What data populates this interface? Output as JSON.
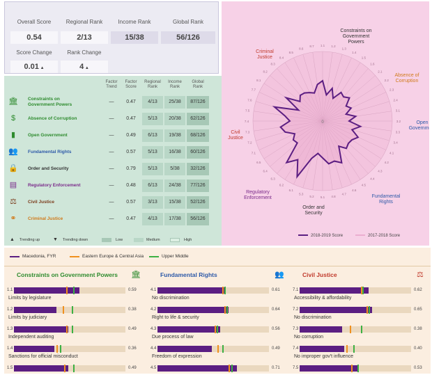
{
  "score": {
    "labels": {
      "overall": "Overall Score",
      "regional": "Regional Rank",
      "income": "Income Rank",
      "global": "Global Rank",
      "change": "Score Change",
      "rank_change": "Rank Change"
    },
    "values": {
      "overall": "0.54",
      "regional": "2/13",
      "income": "15/38",
      "global": "56/126",
      "change": "0.01",
      "rank_change": "4"
    }
  },
  "table": {
    "headers": {
      "trend": "Factor\nTrend",
      "score": "Factor\nScore",
      "regional": "Regional\nRank",
      "income": "Income\nRank",
      "global": "Global\nRank"
    },
    "rows": [
      {
        "name": "Constraints on\nGovernment Powers",
        "color": "#2e8b2e",
        "icon": "building-icon",
        "glyph": "🏛",
        "trend": "—",
        "score": "0.47",
        "regional": "4/13",
        "income": "25/38",
        "global": "87/126"
      },
      {
        "name": "Absence of Corruption",
        "color": "#2e8b2e",
        "icon": "money-bag-icon",
        "glyph": "$",
        "trend": "—",
        "score": "0.47",
        "regional": "5/13",
        "income": "20/38",
        "global": "62/126"
      },
      {
        "name": "Open Government",
        "color": "#2e8b2e",
        "icon": "door-icon",
        "glyph": "▮",
        "trend": "—",
        "score": "0.49",
        "regional": "6/13",
        "income": "19/38",
        "global": "68/126"
      },
      {
        "name": "Fundamental Rights",
        "color": "#2e5aa8",
        "icon": "people-icon",
        "glyph": "👥",
        "trend": "—",
        "score": "0.57",
        "regional": "5/13",
        "income": "16/38",
        "global": "60/126"
      },
      {
        "name": "Order and Security",
        "color": "#333333",
        "icon": "lock-icon",
        "glyph": "🔒",
        "trend": "—",
        "score": "0.79",
        "regional": "5/13",
        "income": "5/38",
        "global": "32/126"
      },
      {
        "name": "Regulatory Enforcement",
        "color": "#7a2a8a",
        "icon": "document-icon",
        "glyph": "▤",
        "trend": "—",
        "score": "0.48",
        "regional": "6/13",
        "income": "24/38",
        "global": "77/126"
      },
      {
        "name": "Civil Justice",
        "color": "#7a3a1a",
        "icon": "scales-icon",
        "glyph": "⚖",
        "trend": "—",
        "score": "0.57",
        "regional": "3/13",
        "income": "15/38",
        "global": "52/126"
      },
      {
        "name": "Criminal Justice",
        "color": "#d07a1a",
        "icon": "handcuffs-icon",
        "glyph": "⚭",
        "trend": "—",
        "score": "0.47",
        "regional": "4/13",
        "income": "17/38",
        "global": "56/126"
      }
    ],
    "legend": {
      "up": "Trending up",
      "down": "Trending down",
      "low": "Low",
      "medium": "Medium",
      "high": "High"
    }
  },
  "radar": {
    "labels": {
      "constraints": "Constraints on\nGovernment\nPowers",
      "corruption": "Absence of\nCorruption",
      "open": "Open\nGovernment",
      "rights": "Fundamental\nRights",
      "order": "Order and\nSecurity",
      "regulatory": "Regulatory\nEnforcement",
      "civil": "Civil\nJustice",
      "criminal": "Criminal\nJustice"
    },
    "center": "0",
    "legend": {
      "current": "2018-2019 Score",
      "previous": "2017-2018 Score"
    },
    "colors": {
      "current": "#5b1e82",
      "previous": "#e7a3c8"
    },
    "current": [
      0.58,
      0.38,
      0.49,
      0.36,
      0.49,
      0.46,
      0.51,
      0.4,
      0.45,
      0.35,
      0.48,
      0.38,
      0.55,
      0.44,
      0.56,
      0.5,
      0.49,
      0.52,
      0.43,
      0.66,
      0.6,
      0.62,
      0.53,
      0.47,
      0.56,
      0.88,
      0.66,
      0.79,
      0.48,
      0.5,
      0.44,
      0.56,
      0.61,
      0.47,
      0.55,
      0.72,
      0.38,
      0.62,
      0.43,
      0.49,
      0.48,
      0.45,
      0.42,
      0.53
    ],
    "previous": [
      0.56,
      0.4,
      0.48,
      0.37,
      0.48,
      0.45,
      0.5,
      0.41,
      0.44,
      0.36,
      0.47,
      0.39,
      0.54,
      0.45,
      0.55,
      0.49,
      0.48,
      0.51,
      0.44,
      0.65,
      0.59,
      0.61,
      0.52,
      0.48,
      0.55,
      0.86,
      0.65,
      0.78,
      0.49,
      0.49,
      0.45,
      0.55,
      0.6,
      0.48,
      0.54,
      0.71,
      0.39,
      0.61,
      0.44,
      0.48,
      0.49,
      0.46,
      0.43,
      0.52
    ],
    "tick_labels": [
      "1.1",
      "1.2",
      "1.3",
      "1.4",
      "1.5",
      "1.6",
      "2.1",
      "2.2",
      "2.3",
      "2.4",
      "3.1",
      "3.2",
      "3.3",
      "3.4",
      "4.1",
      "4.2",
      "4.3",
      "4.4",
      "4.5",
      "4.6",
      "4.7",
      "4.8",
      "5.1",
      "5.2",
      "5.3",
      "6.1",
      "6.2",
      "6.3",
      "6.4",
      "6.5",
      "7.1",
      "7.2",
      "7.3",
      "7.4",
      "7.5",
      "7.6",
      "7.7",
      "8.1",
      "8.2",
      "8.3",
      "8.4",
      "8.5",
      "8.6",
      "8.7"
    ]
  },
  "bars": {
    "legend": {
      "country": "Macedonia, FYR",
      "region": "Eastern Europe & Central Asia",
      "income": "Upper Middle"
    },
    "colors": {
      "country": "#5b1e82",
      "region": "#f0901e",
      "income": "#3cb043"
    },
    "groups": [
      {
        "title": "Constraints on Government Powers",
        "title_color": "#2e8b2e",
        "icon": "building-icon",
        "glyph": "🏛",
        "items": [
          {
            "num": "1.1",
            "label": "Limits by legislature",
            "value": 0.59,
            "region": 0.47,
            "income": 0.53
          },
          {
            "num": "1.2",
            "label": "Limits by judiciary",
            "value": 0.38,
            "region": 0.44,
            "income": 0.52
          },
          {
            "num": "1.3",
            "label": "Independent auditing",
            "value": 0.49,
            "region": 0.47,
            "income": 0.52
          },
          {
            "num": "1.4",
            "label": "Sanctions for official misconduct",
            "value": 0.36,
            "region": 0.38,
            "income": 0.41
          },
          {
            "num": "1.5",
            "label": "",
            "value": 0.49,
            "region": 0.45,
            "income": 0.53
          }
        ]
      },
      {
        "title": "Fundamental Rights",
        "title_color": "#2e5aa8",
        "icon": "people-icon",
        "glyph": "👥",
        "items": [
          {
            "num": "4.1",
            "label": "No discrimination",
            "value": 0.61,
            "region": 0.58,
            "income": 0.6
          },
          {
            "num": "4.2",
            "label": "Right to life & security",
            "value": 0.64,
            "region": 0.6,
            "income": 0.62
          },
          {
            "num": "4.3",
            "label": "Due process of law",
            "value": 0.56,
            "region": 0.51,
            "income": 0.53
          },
          {
            "num": "4.4",
            "label": "Freedom of expression",
            "value": 0.49,
            "region": 0.54,
            "income": 0.58
          },
          {
            "num": "4.5",
            "label": "",
            "value": 0.71,
            "region": 0.64,
            "income": 0.66
          }
        ]
      },
      {
        "title": "Civil Justice",
        "title_color": "#c0392b",
        "icon": "scales-icon",
        "glyph": "⚖",
        "items": [
          {
            "num": "7.1",
            "label": "Accessibility & affordability",
            "value": 0.62,
            "region": 0.55,
            "income": 0.56
          },
          {
            "num": "7.2",
            "label": "No discrimination",
            "value": 0.65,
            "region": 0.6,
            "income": 0.62
          },
          {
            "num": "7.3",
            "label": "No corruption",
            "value": 0.38,
            "region": 0.45,
            "income": 0.55
          },
          {
            "num": "7.4",
            "label": "No improper gov't influence",
            "value": 0.4,
            "region": 0.42,
            "income": 0.48
          },
          {
            "num": "7.5",
            "label": "",
            "value": 0.53,
            "region": 0.46,
            "income": 0.52
          }
        ]
      }
    ]
  }
}
